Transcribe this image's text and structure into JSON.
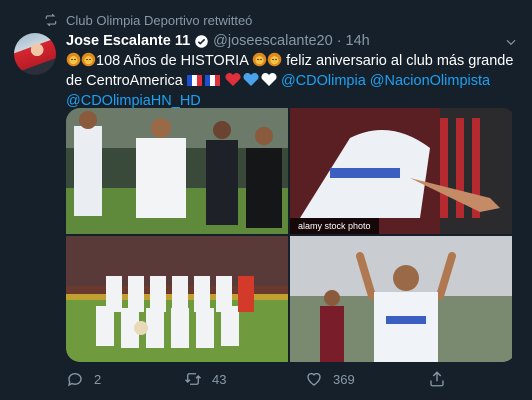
{
  "retweet": {
    "icon": "retweet-icon",
    "text": "Club Olimpia Deportivo retwitteó"
  },
  "tweet": {
    "author_name": "Jose Escalante 11",
    "handle": "@joseescalante20",
    "dot": "·",
    "time": "14h",
    "verified_icon": "verified-badge-icon",
    "text_part1": "108 Años de HISTORIA",
    "text_part2": "feliz aniversario al club más grande de CentroAmerica",
    "emoji_flags": "🇫🇷🇫🇷",
    "emoji_hearts": "❤💙🤍",
    "mention1": "@CDOlimpia",
    "mention2": "@NacionOlimpista",
    "mention3": "@CDOlimpiaHN_HD"
  },
  "media": {
    "watermark": "alamy stock photo",
    "photos": [
      "team-players-photo",
      "player-closeup-photo",
      "team-lineup-photo",
      "player-celebrating-photo"
    ]
  },
  "actions": {
    "reply_count": "2",
    "retweet_count": "43",
    "like_count": "369",
    "icons": [
      "reply-icon",
      "retweet-icon",
      "like-icon",
      "share-icon"
    ]
  },
  "colors": {
    "background": "#15202b",
    "secondary_text": "#8899a6",
    "link": "#1da1f2"
  }
}
